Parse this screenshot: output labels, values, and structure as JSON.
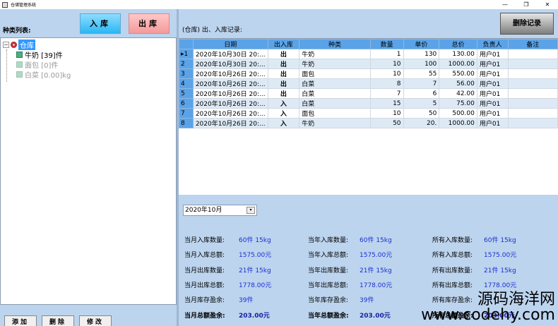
{
  "window": {
    "title": "仓储管理系统",
    "controls": [
      "—",
      "❐",
      "✕"
    ]
  },
  "left": {
    "category_label": "种类列表:",
    "btn_in": "入库",
    "btn_out": "出库",
    "tree": {
      "root": "仓库",
      "items": [
        {
          "label": "牛奶 [39]件",
          "dim": false
        },
        {
          "label": "面包 [0]件",
          "dim": true
        },
        {
          "label": "白菜 [0.00]kg",
          "dim": true
        }
      ]
    },
    "btn_add": "添加",
    "btn_delete": "删除",
    "btn_edit": "修改"
  },
  "right": {
    "title": "(仓库) 出、入库记录:",
    "btn_delete_records": "删除记录",
    "columns": [
      "日期",
      "出入库",
      "种类",
      "数量",
      "单价",
      "总价",
      "负责人",
      "备注"
    ],
    "rows": [
      {
        "marker": "▸1",
        "date": "2020年10月30日 20:...",
        "io": "出",
        "kind": "牛奶",
        "qty": "1",
        "price": "130",
        "total": "130.00",
        "person": "用户01",
        "note": ""
      },
      {
        "marker": "2",
        "date": "2020年10月30日 20:...",
        "io": "出",
        "kind": "牛奶",
        "qty": "10",
        "price": "100",
        "total": "1000.00",
        "person": "用户01",
        "note": ""
      },
      {
        "marker": "3",
        "date": "2020年10月26日 20:...",
        "io": "出",
        "kind": "面包",
        "qty": "10",
        "price": "55",
        "total": "550.00",
        "person": "用户01",
        "note": ""
      },
      {
        "marker": "4",
        "date": "2020年10月26日 20:...",
        "io": "出",
        "kind": "白菜",
        "qty": "8",
        "price": "7",
        "total": "56.00",
        "person": "用户01",
        "note": ""
      },
      {
        "marker": "5",
        "date": "2020年10月26日 20:...",
        "io": "出",
        "kind": "白菜",
        "qty": "7",
        "price": "6",
        "total": "42.00",
        "person": "用户01",
        "note": ""
      },
      {
        "marker": "6",
        "date": "2020年10月26日 20:...",
        "io": "入",
        "kind": "白菜",
        "qty": "15",
        "price": "5",
        "total": "75.00",
        "person": "用户01",
        "note": ""
      },
      {
        "marker": "7",
        "date": "2020年10月26日 20:...",
        "io": "入",
        "kind": "面包",
        "qty": "10",
        "price": "50",
        "total": "500.00",
        "person": "用户01",
        "note": ""
      },
      {
        "marker": "8",
        "date": "2020年10月26日 20:...",
        "io": "入",
        "kind": "牛奶",
        "qty": "50",
        "price": "20.",
        "total": "1000.00",
        "person": "用户01",
        "note": ""
      }
    ],
    "month": "2020年10月",
    "stats": {
      "month": [
        {
          "label": "当月入库数量:",
          "value": "60件 15kg"
        },
        {
          "label": "当月入库总额:",
          "value": "1575.00元"
        },
        {
          "label": "当月出库数量:",
          "value": "21件 15kg"
        },
        {
          "label": "当月出库总额:",
          "value": "1778.00元"
        },
        {
          "label": "当月库存盈余:",
          "value": "39件"
        },
        {
          "label": "当月总额盈余:",
          "value": "203.00元"
        }
      ],
      "year": [
        {
          "label": "当年入库数量:",
          "value": "60件 15kg"
        },
        {
          "label": "当年入库总额:",
          "value": "1575.00元"
        },
        {
          "label": "当年出库数量:",
          "value": "21件 15kg"
        },
        {
          "label": "当年出库总额:",
          "value": "1778.00元"
        },
        {
          "label": "当年库存盈余:",
          "value": "39件"
        },
        {
          "label": "当年总额盈余:",
          "value": "203.00元"
        }
      ],
      "all": [
        {
          "label": "所有入库数量:",
          "value": "60件 15kg"
        },
        {
          "label": "所有入库总额:",
          "value": "1575.00元"
        },
        {
          "label": "所有出库数量:",
          "value": "21件 15kg"
        },
        {
          "label": "所有出库总额:",
          "value": "1778.00元"
        },
        {
          "label": "所有库存盈余:",
          "value": ""
        },
        {
          "label": "所有总额盈余:",
          "value": "203.00元"
        }
      ]
    }
  },
  "watermark": {
    "line1": "源码海洋网",
    "line2": "www.codehy.com"
  }
}
